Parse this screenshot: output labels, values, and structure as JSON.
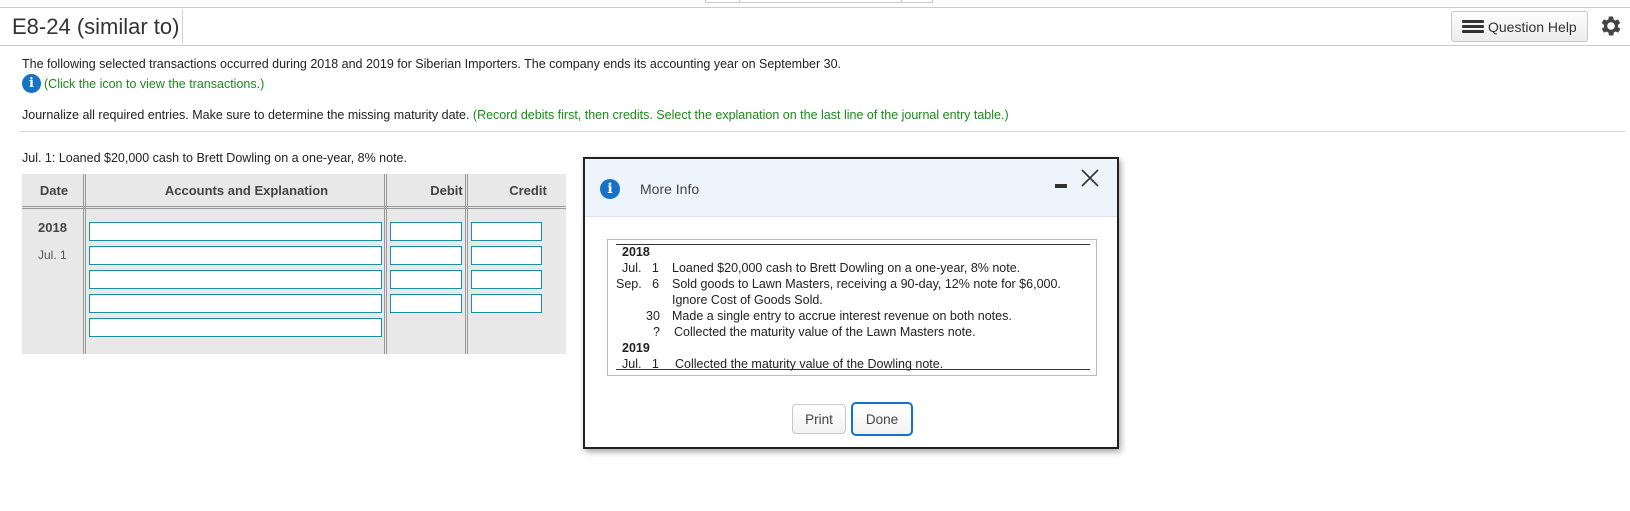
{
  "header": {
    "title": "E8-24 (similar to)",
    "help_label": "Question Help"
  },
  "problem": {
    "intro": "The following selected transactions occurred during 2018 and 2019 for Siberian Importers. The company ends its accounting year on September 30.",
    "info_link": "(Click the icon to view the transactions.)",
    "instruction_main": "Journalize all required entries. Make sure to determine the missing maturity date. ",
    "instruction_green": "(Record debits first, then credits. Select the explanation on the last line of the journal entry table.)",
    "transaction_label": "Jul. 1: Loaned $20,000 cash to Brett Dowling on a one-year, 8% note."
  },
  "journal": {
    "headers": {
      "date": "Date",
      "accounts": "Accounts and Explanation",
      "debit": "Debit",
      "credit": "Credit"
    },
    "year": "2018",
    "day": "Jul. 1"
  },
  "modal": {
    "title": "More Info",
    "rows": {
      "y2018": "2018",
      "r1_date": "Jul.   1",
      "r1_text": "Loaned $20,000 cash to Brett Dowling on a one-year, 8% note.",
      "r2_date": "Sep.   6",
      "r2_text": "Sold goods to Lawn Masters, receiving a 90-day, 12% note for $6,000.",
      "r2_text2": "Ignore Cost of Goods Sold.",
      "r3_date": "30",
      "r3_text": "Made a single entry to accrue interest revenue on both notes.",
      "r4_date": "?",
      "r4_text": "Collected the maturity value of the Lawn Masters note.",
      "y2019": "2019",
      "r5_date": "Jul.   1",
      "r5_text": "Collected the maturity value of the Dowling note."
    },
    "print_label": "Print",
    "done_label": "Done"
  },
  "colors": {
    "info_blue": "#1672c7",
    "hint_green": "#1a8a1a",
    "input_border": "#1b8ea0"
  }
}
